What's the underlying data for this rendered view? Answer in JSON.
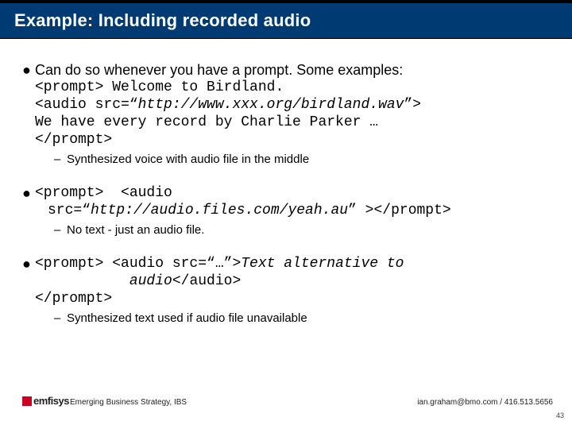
{
  "title": "Example: Including recorded audio",
  "bullets": [
    {
      "lead": "Can do so whenever you have a prompt. Some examples:",
      "code_lines": [
        {
          "text": "<prompt> Welcome to Birdland.",
          "italic": false
        },
        {
          "text": "<audio src=\"http://www.xxx.org/birdland.wav\">",
          "italic": true,
          "prefix": "",
          "italic_span": "http://www.xxx.org/birdland.wav"
        },
        {
          "text": "We have every record by Charlie Parker …",
          "italic": false
        },
        {
          "text": "</prompt>",
          "italic": false
        }
      ],
      "sub": "Synthesized voice with audio file in the middle"
    },
    {
      "lead": "",
      "code_lines": [
        {
          "text": "<prompt>  <audio",
          "italic": false
        },
        {
          "text": "src=\"http://audio.files.com/yeah.au\" ></prompt>",
          "italic": true,
          "indent": true,
          "italic_span": "http://audio.files.com/yeah.au"
        }
      ],
      "sub": "No text  - just an audio file."
    },
    {
      "lead": "",
      "code_lines": [
        {
          "text": "<prompt> <audio src=\"…\">Text alternative to",
          "italic": true,
          "italic_span": "Text alternative to"
        },
        {
          "text": "           audio</audio>",
          "italic": true,
          "italic_span": "audio",
          "indent2": true
        },
        {
          "text": "</prompt>",
          "italic": false
        }
      ],
      "sub": "Synthesized text used if audio file unavailable"
    }
  ],
  "logo_text": "emfisys",
  "footer_left": "Emerging Business Strategy, IBS",
  "footer_right": "ian.graham@bmo.com / 416.513.5656",
  "page_number": "43"
}
